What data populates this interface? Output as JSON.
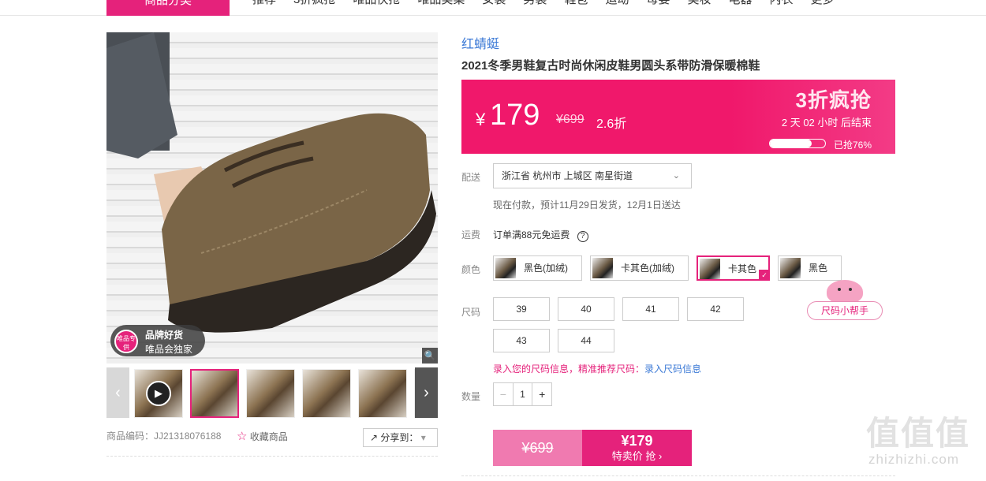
{
  "nav": {
    "category_btn": "商品分类",
    "links": [
      "推荐",
      "3折疯抢",
      "唯品快抢",
      "唯品美菜",
      "女装",
      "男装",
      "鞋包",
      "运动",
      "母婴",
      "美妆",
      "电器",
      "内衣",
      "更多"
    ]
  },
  "gallery": {
    "badge_line1": "品牌好货",
    "badge_line2": "唯品会独家",
    "badge_circle": "唯品专供",
    "zoom_icon": "🔍",
    "prev_arrow": "‹",
    "next_arrow": "›",
    "play_icon": "▶"
  },
  "product_code": "商品编码：JJ21318076188",
  "favorite": "收藏商品",
  "share": "分享到：",
  "brand": "红蜻蜓",
  "title": "2021冬季男鞋复古时尚休闲皮鞋男圆头系带防滑保暖棉鞋",
  "price": {
    "currency": "¥",
    "current": "179",
    "original": "¥699",
    "discount": "2.6折",
    "flash_label": "3折疯抢",
    "countdown": "2 天 02 小时 后结束",
    "sold_percent": 76,
    "sold_text": "已抢76%"
  },
  "delivery": {
    "label": "配送",
    "address": "浙江省 杭州市 上城区 南星街道",
    "chevron": "⌄",
    "note": "现在付款，预计11月29日发货，12月1日送达"
  },
  "freight": {
    "label": "运费",
    "text": "订单满88元免运费",
    "icon": "?"
  },
  "color": {
    "label": "颜色",
    "options": [
      "黑色(加绒)",
      "卡其色(加绒)",
      "卡其色",
      "黑色"
    ],
    "selected": "卡其色",
    "check": "✓"
  },
  "size": {
    "label": "尺码",
    "options": [
      "39",
      "40",
      "41",
      "42",
      "43",
      "44"
    ],
    "helper": "尺码小帮手",
    "hint": "录入您的尺码信息，精准推荐尺码：",
    "hint_link": "录入尺码信息"
  },
  "quantity": {
    "label": "数量",
    "minus": "−",
    "value": "1",
    "plus": "+"
  },
  "buy": {
    "original": "¥699",
    "price": "¥179",
    "action": "特卖价 抢 ›"
  },
  "watermark": {
    "big": "值值值",
    "small": "zhizhizhi.com"
  },
  "colors": {
    "accent": "#e5227b",
    "price_bg": "#f0186b",
    "link": "#3c7ad6"
  }
}
